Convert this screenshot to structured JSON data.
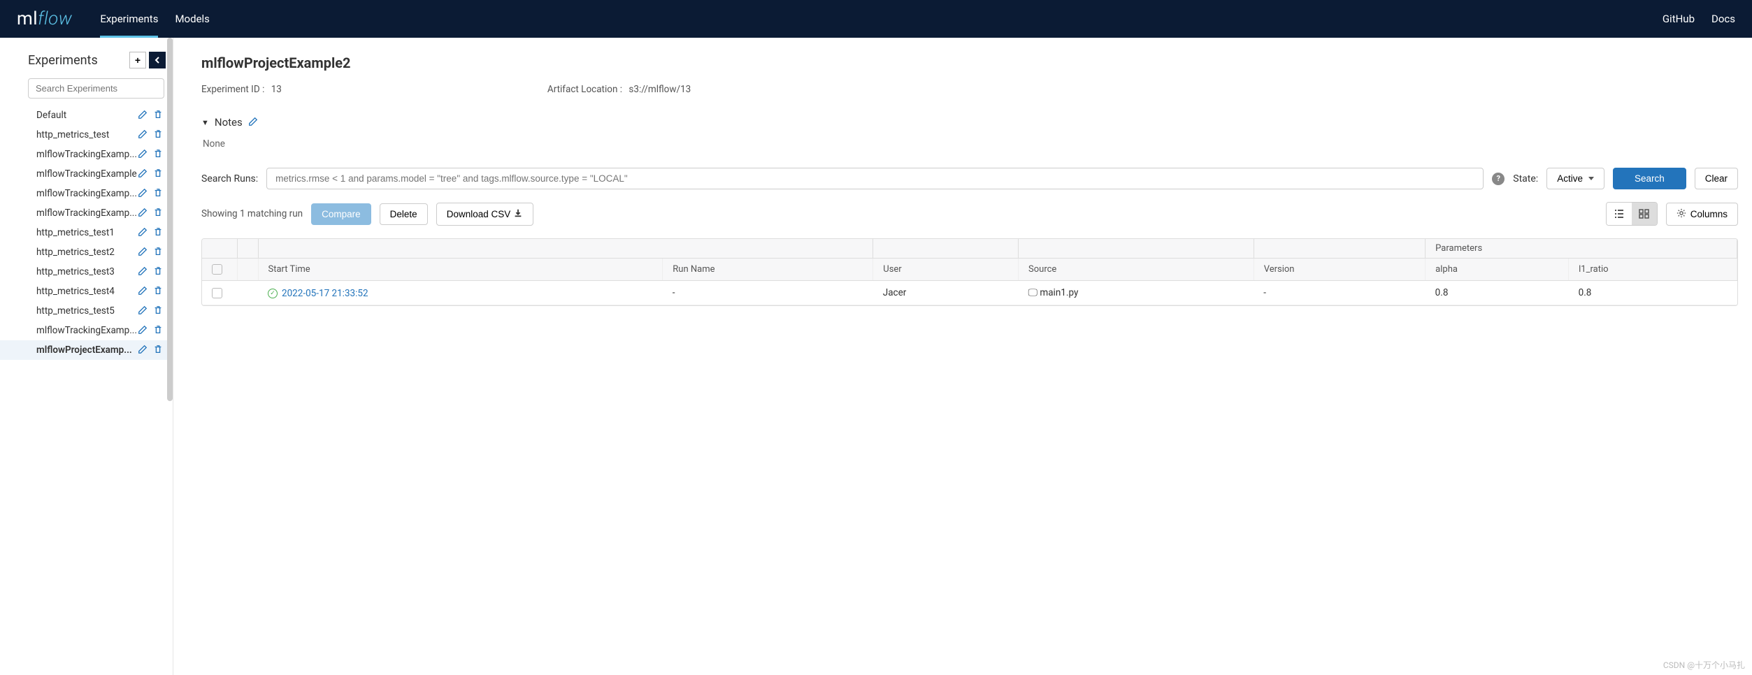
{
  "header": {
    "nav": {
      "experiments": "Experiments",
      "models": "Models"
    },
    "right": {
      "github": "GitHub",
      "docs": "Docs"
    }
  },
  "sidebar": {
    "title": "Experiments",
    "search_placeholder": "Search Experiments",
    "items": [
      {
        "name": "Default"
      },
      {
        "name": "http_metrics_test"
      },
      {
        "name": "mlflowTrackingExamp..."
      },
      {
        "name": "mlflowTrackingExample"
      },
      {
        "name": "mlflowTrackingExamp..."
      },
      {
        "name": "mlflowTrackingExamp..."
      },
      {
        "name": "http_metrics_test1"
      },
      {
        "name": "http_metrics_test2"
      },
      {
        "name": "http_metrics_test3"
      },
      {
        "name": "http_metrics_test4"
      },
      {
        "name": "http_metrics_test5"
      },
      {
        "name": "mlflowTrackingExamp..."
      },
      {
        "name": "mlflowProjectExamp..."
      }
    ]
  },
  "page": {
    "title": "mlflowProjectExample2",
    "exp_id_label": "Experiment ID :",
    "exp_id_value": "13",
    "artifact_label": "Artifact Location :",
    "artifact_value": "s3://mlflow/13",
    "notes_label": "Notes",
    "notes_content": "None"
  },
  "search": {
    "label": "Search Runs:",
    "placeholder": "metrics.rmse < 1 and params.model = \"tree\" and tags.mlflow.source.type = \"LOCAL\"",
    "state_label": "State:",
    "active_btn": "Active",
    "search_btn": "Search",
    "clear_btn": "Clear"
  },
  "toolbar": {
    "showing": "Showing 1 matching run",
    "compare": "Compare",
    "delete": "Delete",
    "download": "Download CSV",
    "columns": "Columns"
  },
  "table": {
    "group_params": "Parameters",
    "headers": {
      "start_time": "Start Time",
      "run_name": "Run Name",
      "user": "User",
      "source": "Source",
      "version": "Version",
      "alpha": "alpha",
      "l1_ratio": "l1_ratio"
    },
    "rows": [
      {
        "start_time": "2022-05-17 21:33:52",
        "run_name": "-",
        "user": "Jacer",
        "source": "main1.py",
        "version": "-",
        "alpha": "0.8",
        "l1_ratio": "0.8"
      }
    ]
  },
  "watermark": "CSDN @十万个小马扎"
}
